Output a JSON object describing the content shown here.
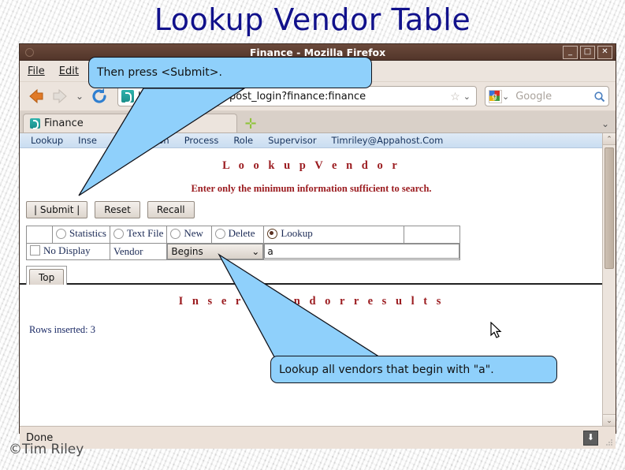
{
  "slide": {
    "title": "Lookup Vendor Table",
    "credit": "©Tim Riley",
    "title_color": "#11118b"
  },
  "window": {
    "title": "Finance - Mozilla Firefox",
    "minimize_label": "_",
    "maximize_label": "□",
    "close_label": "✕"
  },
  "menubar": {
    "items": [
      {
        "label": "File"
      },
      {
        "label": "Edit"
      }
    ]
  },
  "navbar": {
    "back_icon": "back-arrow-icon",
    "forward_icon": "forward-arrow-icon",
    "history_chevron": "⌄",
    "reload_icon": "reload-icon",
    "url": "http://rick/cgi-bin/post_login?finance:finance",
    "bookmark_star": "☆",
    "url_chevron": "⌄",
    "search_engine_chevron": "⌄",
    "search_placeholder": "Google",
    "search_value": "",
    "magnifier_icon": "magnifier-icon"
  },
  "tabstrip": {
    "tab_label": "Finance",
    "new_tab_label": "✛",
    "list_chevron": "⌄"
  },
  "sitenav": {
    "items": [
      {
        "label": "Lookup"
      },
      {
        "label": "Inse"
      },
      {
        "label": "cumentation"
      },
      {
        "label": "Process"
      },
      {
        "label": "Role"
      },
      {
        "label": "Supervisor"
      },
      {
        "label": "Timriley@Appahost.Com"
      }
    ]
  },
  "page": {
    "heading": "L o o k u p   V e n d o r",
    "subheading": "Enter only the minimum information sufficient to search.",
    "buttons": [
      {
        "label": "|  Submit  |"
      },
      {
        "label": "Reset"
      },
      {
        "label": "Recall"
      }
    ],
    "modes": [
      {
        "label": "Statistics",
        "selected": false
      },
      {
        "label": "Text File",
        "selected": false
      },
      {
        "label": "New",
        "selected": false
      },
      {
        "label": "Delete",
        "selected": false
      },
      {
        "label": "Lookup",
        "selected": true
      }
    ],
    "no_display_label": "No Display",
    "field_label": "Vendor",
    "operator_value": "Begins",
    "operator_chevron": "⌄",
    "search_value": "a",
    "top_button_label": "Top"
  },
  "results": {
    "heading": "I n s e r t   V e n d o r   r e s u l t s",
    "rows_inserted": "Rows inserted: 3"
  },
  "statusbar": {
    "text": "Done",
    "download_icon": "⬇"
  },
  "callouts": [
    {
      "id": "submit",
      "text": "Then press <Submit>."
    },
    {
      "id": "lookup",
      "text": "Lookup all vendors that begin with \"a\"."
    }
  ],
  "scrollbar": {
    "up_arrow": "⌃",
    "down_arrow": "⌄"
  },
  "cursor": {
    "icon": "mouse-pointer-icon"
  }
}
